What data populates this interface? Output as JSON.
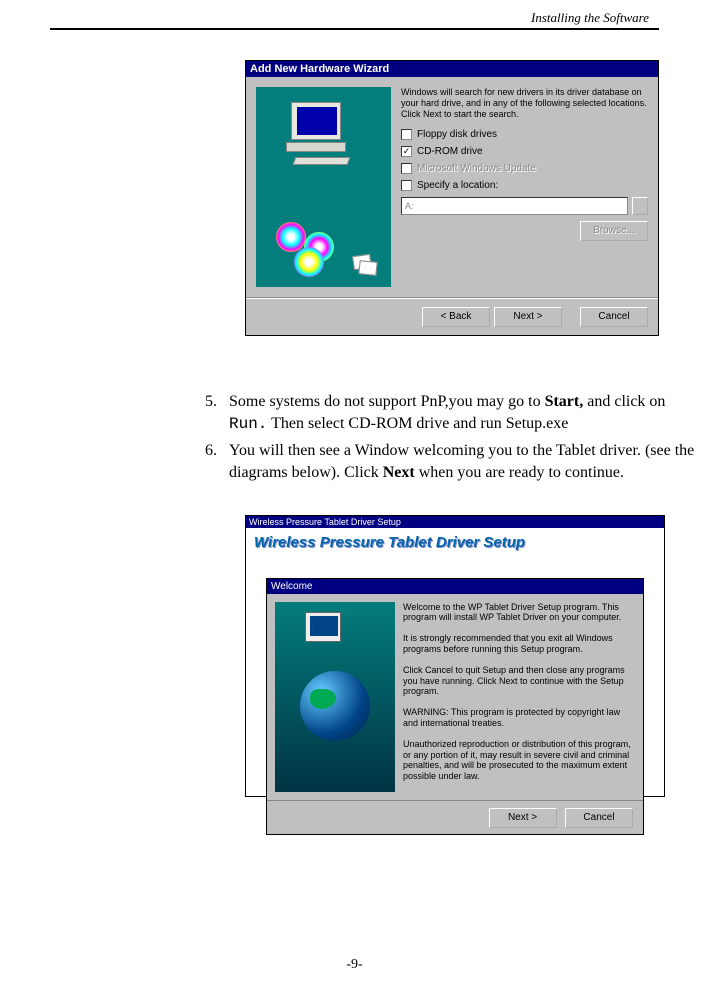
{
  "header": {
    "title": "Installing the Software"
  },
  "wiz1": {
    "title": "Add New Hardware Wizard",
    "intro": "Windows will search for new drivers in its driver database on your hard drive, and in any of the following selected locations. Click Next to start the search.",
    "opt_floppy": "Floppy disk drives",
    "opt_cdrom": "CD-ROM drive",
    "opt_msupdate": "Microsoft Windows Update",
    "opt_specify": "Specify a location:",
    "loc_value": "A:",
    "btn_browse": "Browse...",
    "btn_back": "< Back",
    "btn_next": "Next >",
    "btn_cancel": "Cancel"
  },
  "steps": {
    "s5_num": "5.",
    "s5_a": "Some systems do not support PnP,you may go to",
    "s5_b": "Start,",
    "s5_c": " and click on ",
    "s5_d": "Run.",
    "s5_e": " Then select CD-ROM drive and run Setup.exe",
    "s6_num": "6.",
    "s6_a": "You will then see a Window welcoming you to the Tablet driver. (see the diagrams below). Click ",
    "s6_b": "Next",
    "s6_c": " when you are ready to continue."
  },
  "wiz2": {
    "outer_title": "Wireless Pressure Tablet  Driver Setup",
    "banner": "Wireless Pressure Tablet  Driver Setup",
    "welcome_title": "Welcome",
    "p1": "Welcome to the WP Tablet Driver Setup program. This program will install WP Tablet Driver on your computer.",
    "p2": "It is strongly recommended that you exit all Windows programs before running this Setup program.",
    "p3": "Click Cancel to quit Setup and then close any programs you have running. Click Next to continue with the Setup program.",
    "p4": "WARNING: This program is protected by copyright law and international treaties.",
    "p5": "Unauthorized reproduction or distribution of this program, or any portion of it, may result in severe civil and criminal penalties, and will be prosecuted to the maximum extent possible under law.",
    "btn_next": "Next >",
    "btn_cancel": "Cancel"
  },
  "footer": {
    "page": "-9-"
  }
}
